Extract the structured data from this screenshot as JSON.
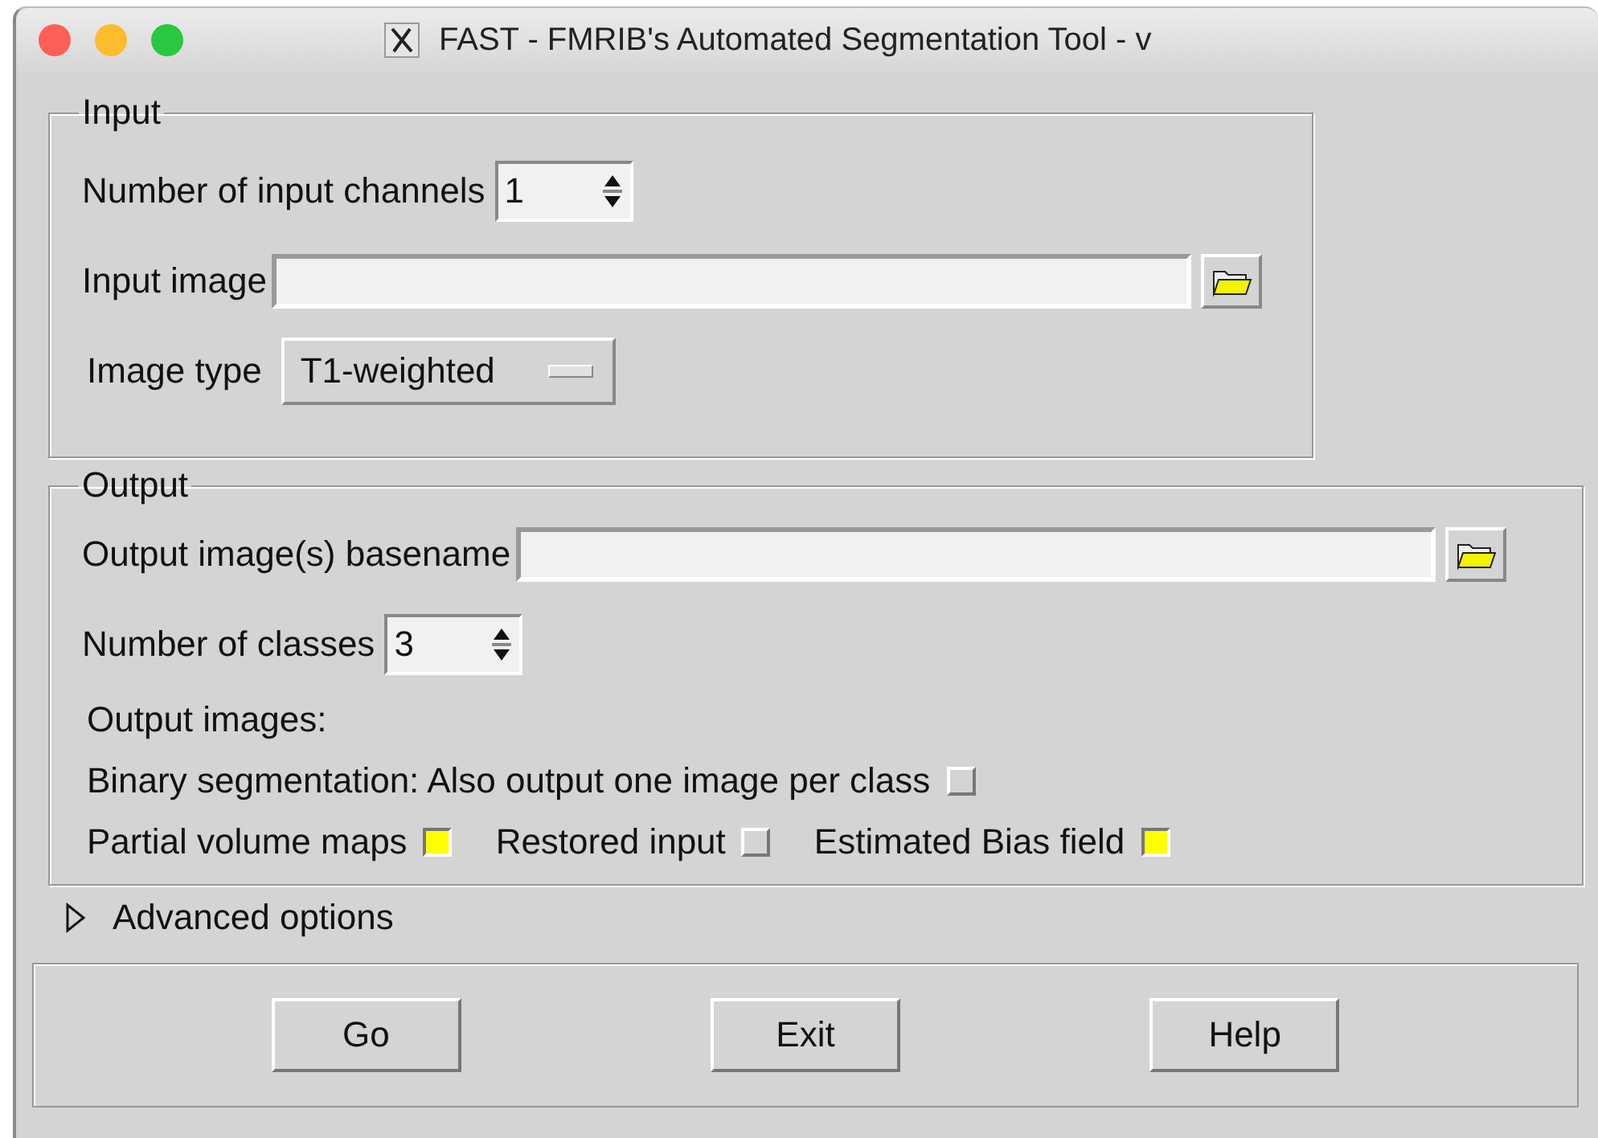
{
  "window": {
    "title": "FAST - FMRIB's Automated Segmentation Tool - v"
  },
  "input": {
    "legend": "Input",
    "channels": {
      "label": "Number of input channels",
      "value": "1"
    },
    "image": {
      "label": "Input image"
    },
    "image_type": {
      "label": "Image type",
      "value": "T1-weighted"
    }
  },
  "output": {
    "legend": "Output",
    "basename": {
      "label": "Output image(s) basename"
    },
    "classes": {
      "label": "Number of classes",
      "value": "3"
    },
    "images_label": "Output images:",
    "binary": {
      "label": "Binary segmentation: Also output one image per class",
      "checked": false
    },
    "options": [
      {
        "label": "Partial volume maps",
        "checked": true
      },
      {
        "label": "Restored input",
        "checked": false
      },
      {
        "label": "Estimated Bias field",
        "checked": true
      }
    ]
  },
  "advanced": {
    "label": "Advanced options",
    "expanded": false
  },
  "buttons": [
    "Go",
    "Exit",
    "Help"
  ]
}
